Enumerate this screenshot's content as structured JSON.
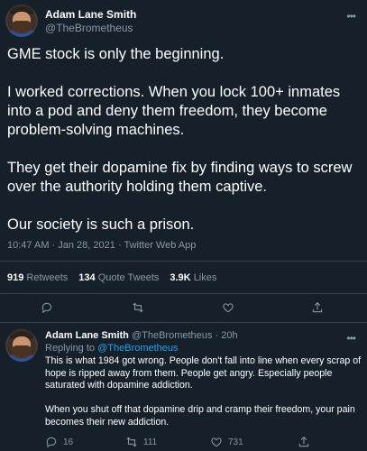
{
  "main_tweet": {
    "display_name": "Adam Lane Smith",
    "handle": "@TheBrometheus",
    "paragraphs": [
      "GME stock is only the beginning.",
      "I worked corrections. When you lock 100+ inmates into a pod and deny them freedom, they become problem-solving machines.",
      "They get their dopamine fix by finding ways to screw over the authority holding them captive.",
      "Our society is such a prison."
    ],
    "timestamp": "10:47 AM · Jan 28, 2021",
    "source": "Twitter Web App",
    "stats": {
      "retweets_count": "919",
      "retweets_label": "Retweets",
      "quotes_count": "134",
      "quotes_label": "Quote Tweets",
      "likes_count": "3.9K",
      "likes_label": "Likes"
    }
  },
  "reply": {
    "display_name": "Adam Lane Smith",
    "handle": "@TheBrometheus",
    "time": "20h",
    "replying_to_label": "Replying to",
    "replying_to_handle": "@TheBrometheus",
    "paragraphs": [
      "This is what 1984 got wrong. People don't fall into line when every scrap of hope is ripped away from them. People get angry. Especially people saturated with dopamine addiction.",
      "When you shut off that dopamine drip and cramp their freedom, your pain becomes their new addiction."
    ],
    "actions": {
      "replies": "16",
      "retweets": "111",
      "likes": "731"
    }
  },
  "icons": {
    "more": "more-icon",
    "reply": "reply-icon",
    "retweet": "retweet-icon",
    "like": "heart-icon",
    "share": "share-icon"
  },
  "colors": {
    "background": "#15202b",
    "muted": "#8899a6",
    "link": "#1da1f2",
    "divider": "#38444d"
  }
}
